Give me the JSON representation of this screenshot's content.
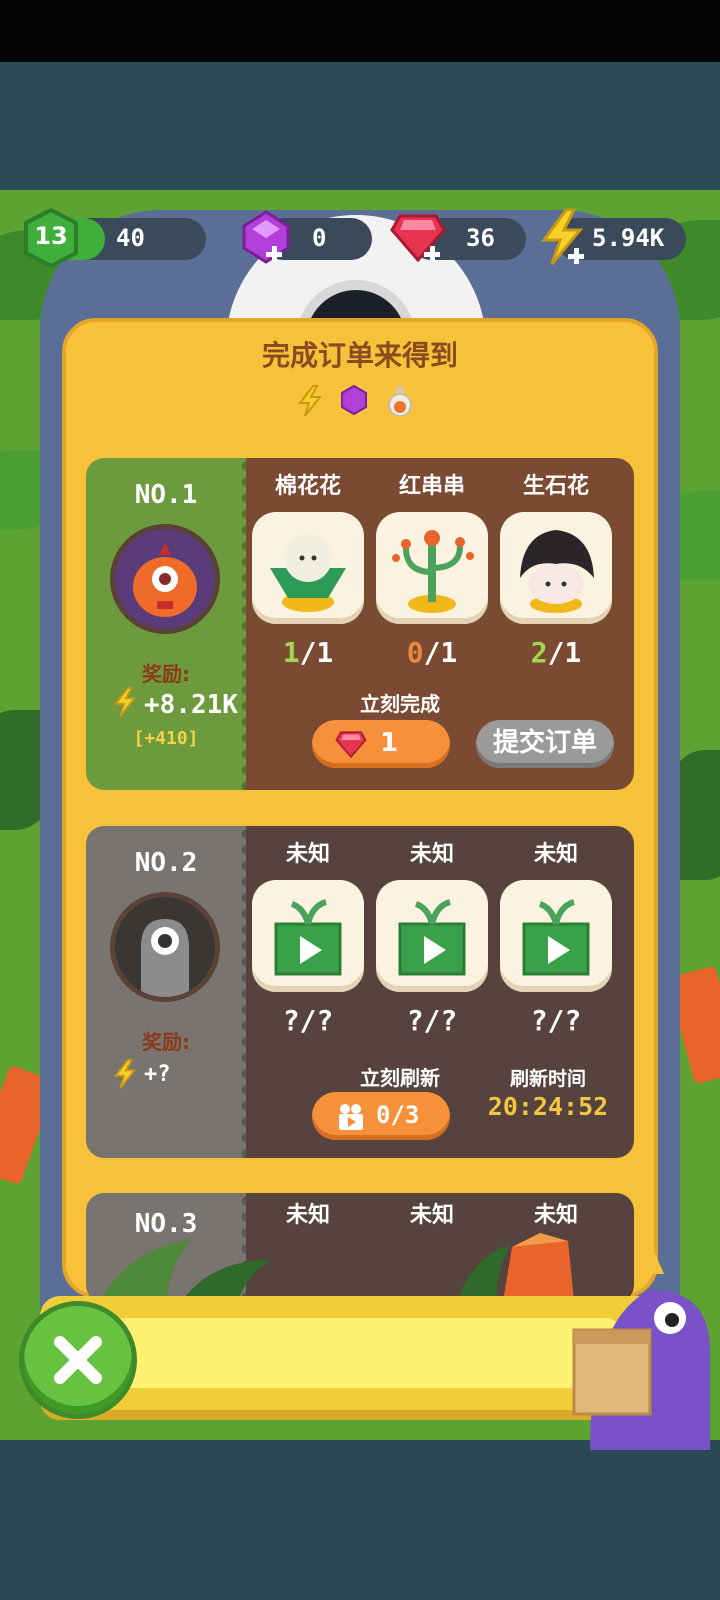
{
  "resources": {
    "level": "13",
    "xp": "40",
    "purple_gems": "0",
    "red_gems": "36",
    "energy": "5.94K"
  },
  "panel": {
    "title": "完成订单来得到",
    "reward_icons": [
      "energy-bolt-icon",
      "purple-gem-icon",
      "potion-icon"
    ]
  },
  "orders": [
    {
      "number": "NO.1",
      "reward_label": "奖励:",
      "reward_value": "+8.21K",
      "reward_bonus": "[+410]",
      "items": [
        {
          "name": "棉花花",
          "have": "1",
          "need": "/1",
          "status": "ok"
        },
        {
          "name": "红串串",
          "have": "0",
          "need": "/1",
          "status": "bad"
        },
        {
          "name": "生石花",
          "have": "2",
          "need": "/1",
          "status": "ok"
        }
      ],
      "instant_label": "立刻完成",
      "instant_cost": "1",
      "submit_label": "提交订单"
    },
    {
      "number": "NO.2",
      "reward_label": "奖励:",
      "reward_value": "+?",
      "items": [
        {
          "name": "未知",
          "count": "?/?"
        },
        {
          "name": "未知",
          "count": "?/?"
        },
        {
          "name": "未知",
          "count": "?/?"
        }
      ],
      "refresh_label": "立刻刷新",
      "refresh_count": "0/3",
      "refresh_time_label": "刷新时间",
      "refresh_time": "20:24:52"
    },
    {
      "number": "NO.3",
      "items": [
        {
          "name": "未知"
        },
        {
          "name": "未知"
        },
        {
          "name": "未知"
        }
      ]
    }
  ],
  "colors": {
    "panel": "#f7c23a",
    "card1_left": "#6d9a3c",
    "card1_right": "#7a4a32",
    "card_locked_left": "#7a7470",
    "card_locked_right": "#56433d",
    "accent_orange": "#f6903a",
    "close_green": "#67c241"
  }
}
